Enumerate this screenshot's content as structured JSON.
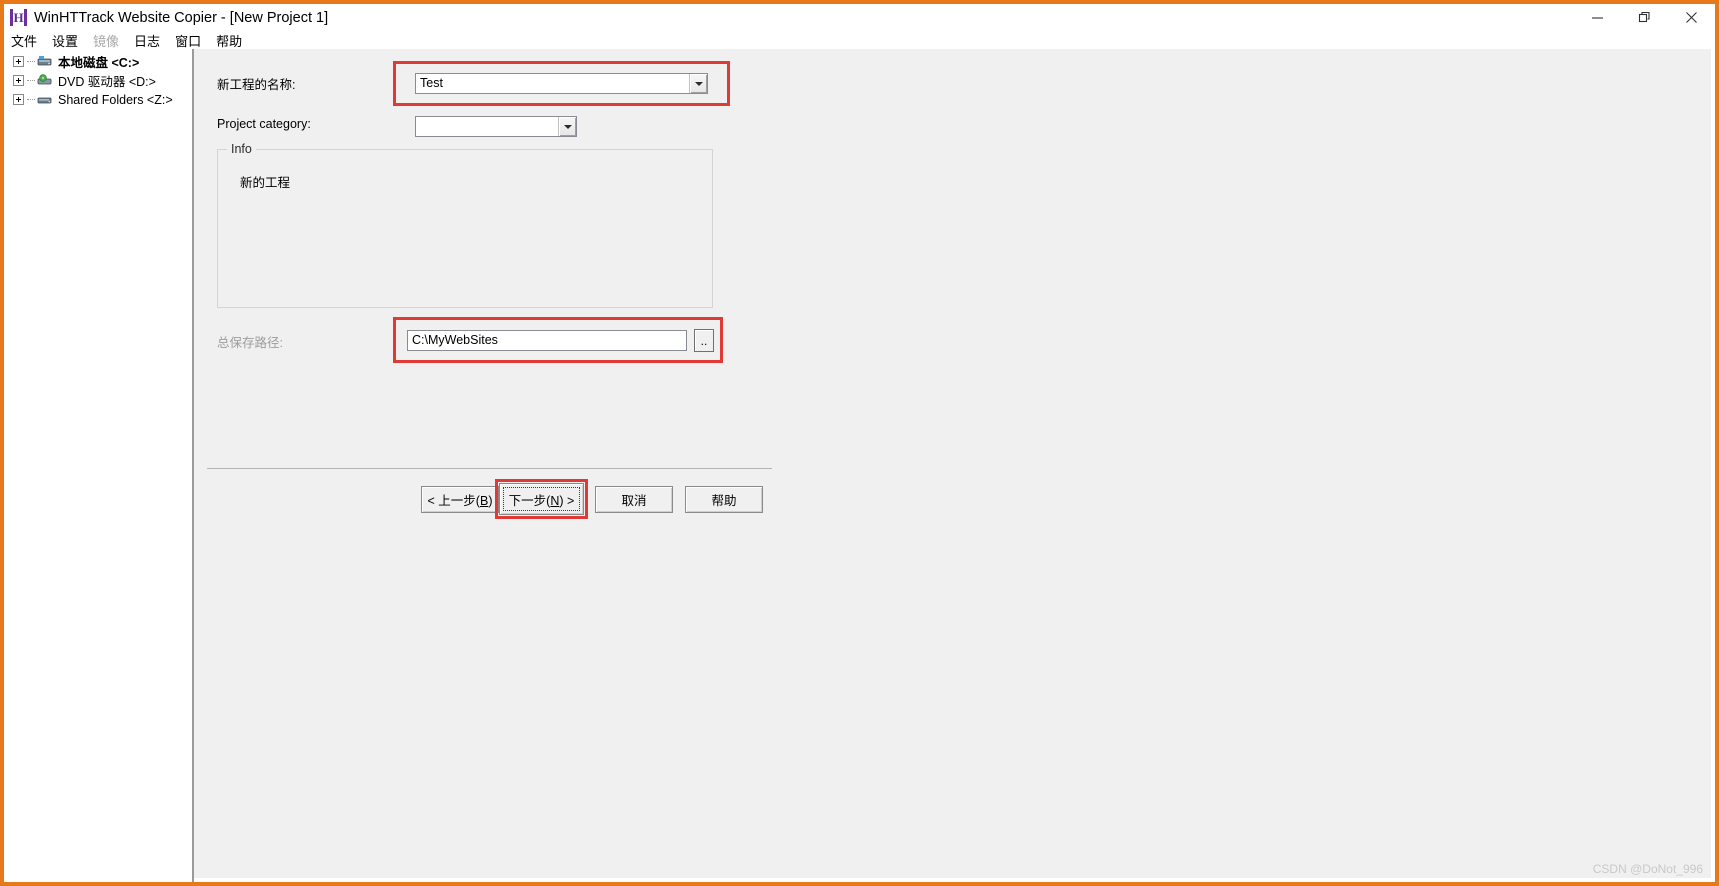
{
  "window": {
    "title": "WinHTTrack Website Copier - [New Project 1]",
    "app_icon_letter": "H",
    "border_color": "#e8791a",
    "controls": [
      {
        "name": "minimize",
        "glyph": "minimize-icon"
      },
      {
        "name": "restore",
        "glyph": "restore-icon"
      },
      {
        "name": "close",
        "glyph": "close-icon"
      }
    ]
  },
  "menubar": {
    "items": [
      {
        "label": "文件",
        "disabled": false
      },
      {
        "label": "设置",
        "disabled": false
      },
      {
        "label": "镜像",
        "disabled": true
      },
      {
        "label": "日志",
        "disabled": false
      },
      {
        "label": "窗口",
        "disabled": false
      },
      {
        "label": "帮助",
        "disabled": false
      }
    ]
  },
  "sidebar": {
    "items": [
      {
        "label": "本地磁盘 <C:>",
        "bold": true,
        "icon": "hard-drive-icon"
      },
      {
        "label": "DVD 驱动器 <D:>",
        "bold": false,
        "icon": "dvd-drive-icon"
      },
      {
        "label": "Shared Folders <Z:>",
        "bold": false,
        "icon": "network-drive-icon"
      }
    ]
  },
  "main": {
    "project_name": {
      "label": "新工程的名称:",
      "value": "Test",
      "highlighted": true
    },
    "project_category": {
      "label": "Project category:",
      "value": ""
    },
    "info_group": {
      "title": "Info",
      "text": "新的工程"
    },
    "save_path": {
      "label": "总保存路径:",
      "label_disabled": true,
      "value": "C:\\MyWebSites",
      "browse_label": "..",
      "highlighted": true
    },
    "buttons": [
      {
        "name": "back",
        "prefix": "< ",
        "text": "上一步(",
        "accel": "B",
        "suffix": ")",
        "focused": false,
        "highlighted": false
      },
      {
        "name": "next",
        "prefix": "",
        "text": "下一步(",
        "accel": "N",
        "suffix": ") >",
        "focused": true,
        "highlighted": true
      },
      {
        "name": "cancel",
        "prefix": "",
        "text": "取消",
        "accel": "",
        "suffix": "",
        "focused": false,
        "highlighted": false
      },
      {
        "name": "help",
        "prefix": "",
        "text": "帮助",
        "accel": "",
        "suffix": "",
        "focused": false,
        "highlighted": false
      }
    ]
  },
  "watermark": {
    "text": "CSDN @DoNot_996"
  },
  "colors": {
    "accent": "#e8791a",
    "annotation": "#e03a36",
    "dialog_bg": "#f0f0f0"
  }
}
